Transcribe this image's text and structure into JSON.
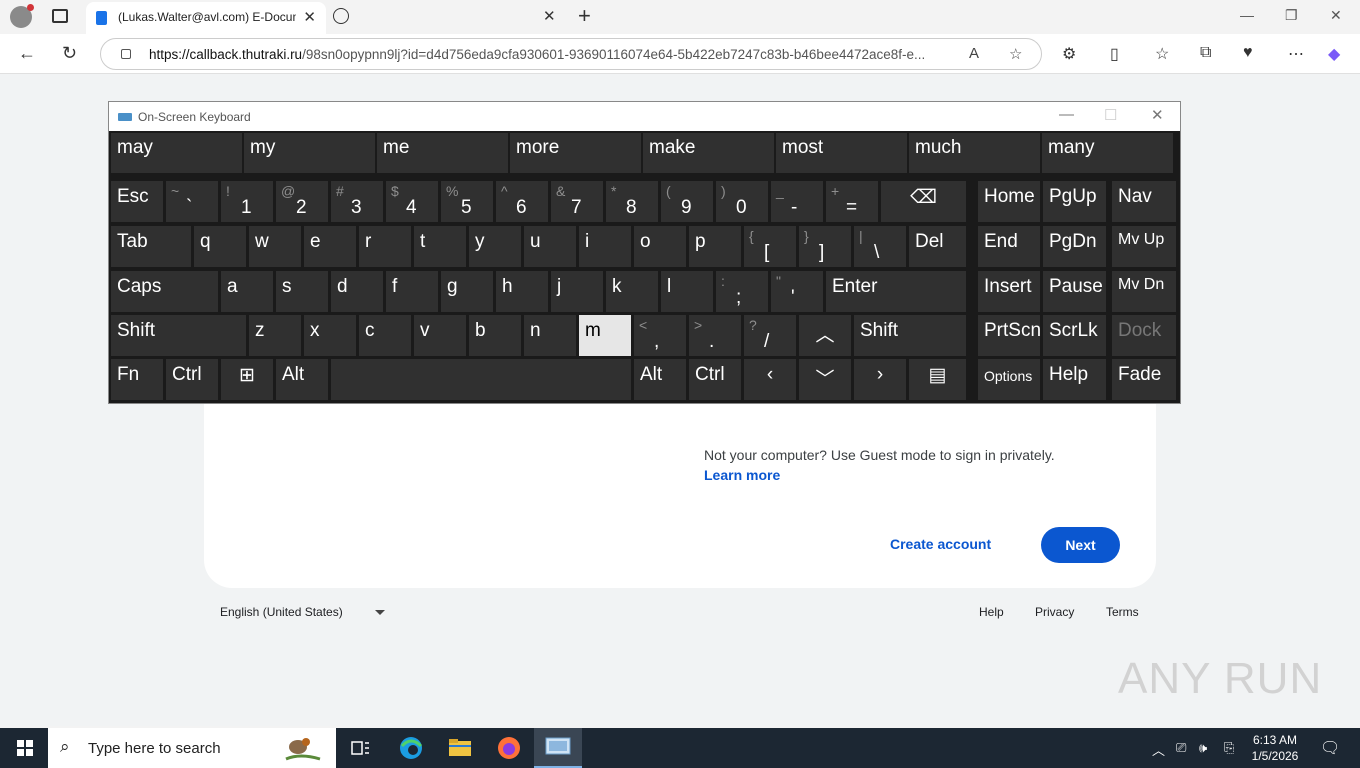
{
  "browser": {
    "tab_title": "(Lukas.Walter@avl.com) E-Docum",
    "url_host": "https://callback.thutraki.ru",
    "url_path": "/98sn0opypnn9lj?id=d4d756eda9cfa930601-93690116074e64-5b422eb7247c83b-b46bee4472ace8f-e..."
  },
  "page": {
    "guest_text": "Not your computer? Use Guest mode to sign in privately.",
    "learn_more": "Learn more",
    "create_account": "Create account",
    "next": "Next",
    "language": "English (United States)",
    "footer": {
      "help": "Help",
      "privacy": "Privacy",
      "terms": "Terms"
    },
    "watermark": "ANY RUN"
  },
  "osk": {
    "title": "On-Screen Keyboard",
    "predictions": [
      "may",
      "my",
      "me",
      "more",
      "make",
      "most",
      "much",
      "many"
    ],
    "keys": {
      "esc": "Esc",
      "tab": "Tab",
      "caps": "Caps",
      "shift": "Shift",
      "fn": "Fn",
      "ctrl": "Ctrl",
      "alt": "Alt",
      "del": "Del",
      "enter": "Enter",
      "home": "Home",
      "pgup": "PgUp",
      "nav": "Nav",
      "end": "End",
      "pgdn": "PgDn",
      "mvup": "Mv Up",
      "insert": "Insert",
      "pause": "Pause",
      "mvdn": "Mv Dn",
      "prtscn": "PrtScn",
      "scrlk": "ScrLk",
      "dock": "Dock",
      "options": "Options",
      "help": "Help",
      "fade": "Fade"
    },
    "row1": [
      {
        "s": "~",
        "b": "`"
      },
      {
        "s": "!",
        "b": "1"
      },
      {
        "s": "@",
        "b": "2"
      },
      {
        "s": "#",
        "b": "3"
      },
      {
        "s": "$",
        "b": "4"
      },
      {
        "s": "%",
        "b": "5"
      },
      {
        "s": "^",
        "b": "6"
      },
      {
        "s": "&",
        "b": "7"
      },
      {
        "s": "*",
        "b": "8"
      },
      {
        "s": "(",
        "b": "9"
      },
      {
        "s": ")",
        "b": "0"
      },
      {
        "s": "_",
        "b": "-"
      },
      {
        "s": "+",
        "b": "="
      }
    ],
    "row2": [
      "q",
      "w",
      "e",
      "r",
      "t",
      "y",
      "u",
      "i",
      "o",
      "p"
    ],
    "row2_sym": [
      {
        "s": "{",
        "b": "["
      },
      {
        "s": "}",
        "b": "]"
      },
      {
        "s": "|",
        "b": "\\"
      }
    ],
    "row3": [
      "a",
      "s",
      "d",
      "f",
      "g",
      "h",
      "j",
      "k",
      "l"
    ],
    "row3_sym": [
      {
        "s": ":",
        "b": ";"
      },
      {
        "s": "\"",
        "b": "'"
      }
    ],
    "row4": [
      "z",
      "x",
      "c",
      "v",
      "b",
      "n",
      "m"
    ],
    "row4_sym": [
      {
        "s": "<",
        "b": ","
      },
      {
        "s": ">",
        "b": "."
      },
      {
        "s": "?",
        "b": "/"
      }
    ]
  },
  "taskbar": {
    "search_placeholder": "Type here to search",
    "time": "6:13 AM",
    "date": "1/5/2026"
  },
  "colors": {
    "accent": "#0b57d0",
    "osk_bg": "#1a1a1a",
    "osk_key": "#303030",
    "taskbar": "#1c2733"
  }
}
